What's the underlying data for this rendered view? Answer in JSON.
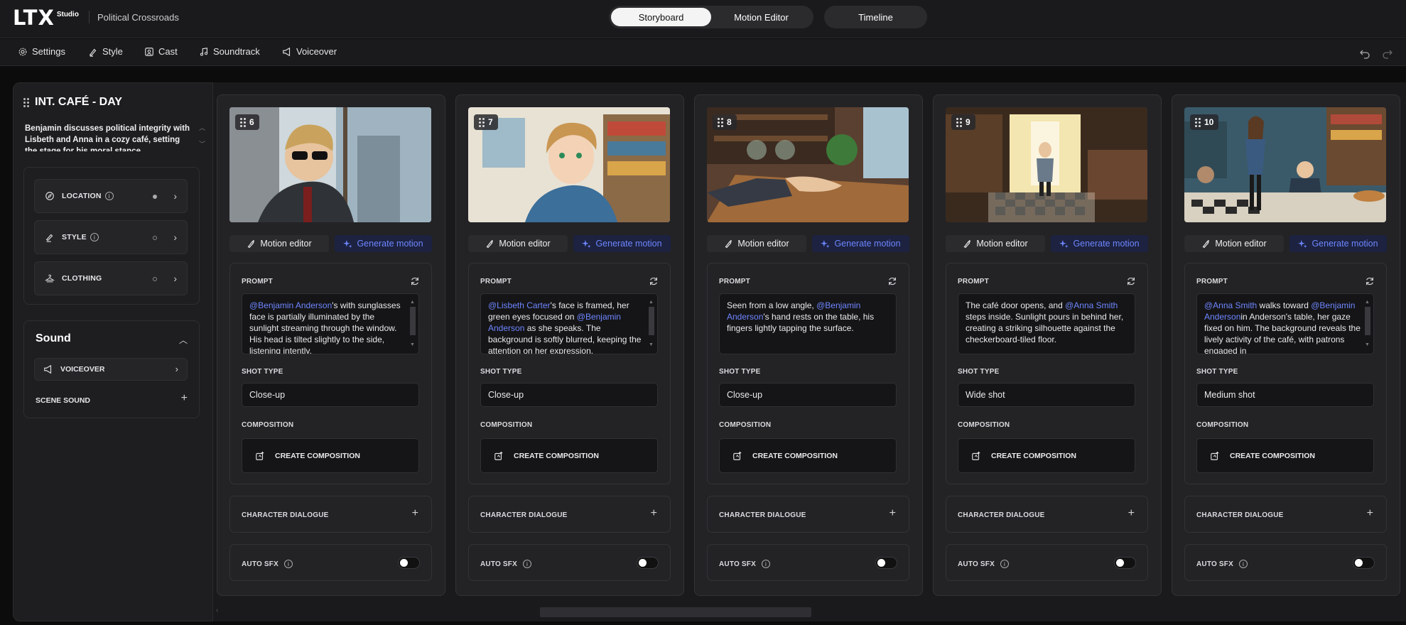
{
  "app": {
    "logo": "LTX",
    "logo_sub": "Studio",
    "project_title": "Political Crossroads"
  },
  "nav": {
    "storyboard": "Storyboard",
    "motion_editor": "Motion Editor",
    "timeline": "Timeline",
    "active": "Storyboard"
  },
  "toolbar": {
    "settings": "Settings",
    "style": "Style",
    "cast": "Cast",
    "soundtrack": "Soundtrack",
    "voiceover": "Voiceover"
  },
  "scene": {
    "title": "INT. CAFÉ - DAY",
    "description": "Benjamin discusses political integrity with Lisbeth and Anna in a cozy café, setting the stage for his moral stance.",
    "attributes": [
      {
        "label": "LOCATION",
        "icon": "compass-icon",
        "filled": true
      },
      {
        "label": "STYLE",
        "icon": "brush-icon",
        "filled": false
      },
      {
        "label": "CLOTHING",
        "icon": "hanger-icon",
        "filled": false
      }
    ],
    "sound": {
      "title": "Sound",
      "voiceover": "VOICEOVER",
      "scene_sound": "SCENE SOUND"
    }
  },
  "labels": {
    "motion_editor": "Motion editor",
    "generate_motion": "Generate motion",
    "prompt": "PROMPT",
    "shot_type": "SHOT TYPE",
    "composition": "COMPOSITION",
    "create_composition": "CREATE COMPOSITION",
    "character_dialogue": "CHARACTER DIALOGUE",
    "auto_sfx": "AUTO SFX"
  },
  "shots": [
    {
      "number": "6",
      "prompt": [
        {
          "t": "@Benjamin Anderson",
          "m": true
        },
        {
          "t": "'s with sunglasses face is partially illuminated by the sunlight streaming through the window. His head is tilted slightly to the side, listening intently.",
          "m": false
        }
      ],
      "shot_type": "Close-up",
      "has_scroll": true,
      "auto_sfx": false
    },
    {
      "number": "7",
      "prompt": [
        {
          "t": "@Lisbeth Carter",
          "m": true
        },
        {
          "t": "'s face is framed, her green eyes focused on ",
          "m": false
        },
        {
          "t": "@Benjamin Anderson",
          "m": true
        },
        {
          "t": " as she speaks. The background is softly blurred, keeping the attention on her expression.",
          "m": false
        }
      ],
      "shot_type": "Close-up",
      "has_scroll": true,
      "auto_sfx": false
    },
    {
      "number": "8",
      "prompt": [
        {
          "t": "Seen from a low angle, ",
          "m": false
        },
        {
          "t": "@Benjamin Anderson",
          "m": true
        },
        {
          "t": "'s hand rests on the table, his fingers lightly tapping the surface.",
          "m": false
        }
      ],
      "shot_type": "Close-up",
      "has_scroll": false,
      "auto_sfx": false
    },
    {
      "number": "9",
      "prompt": [
        {
          "t": "The café door opens, and ",
          "m": false
        },
        {
          "t": "@Anna Smith",
          "m": true
        },
        {
          "t": " steps inside. Sunlight pours in behind her, creating a striking silhouette against the checkerboard-tiled floor.",
          "m": false
        }
      ],
      "shot_type": "Wide shot",
      "has_scroll": false,
      "auto_sfx": false
    },
    {
      "number": "10",
      "prompt": [
        {
          "t": "@Anna Smith",
          "m": true
        },
        {
          "t": " walks toward ",
          "m": false
        },
        {
          "t": "@Benjamin Anderson",
          "m": true
        },
        {
          "t": "in Anderson's table, her gaze fixed on him. The background reveals the lively activity of the café, with patrons engaged in",
          "m": false
        }
      ],
      "shot_type": "Medium shot",
      "has_scroll": true,
      "auto_sfx": false
    }
  ],
  "colors": {
    "accent": "#6e86ff",
    "generate_bg": "#1c2240",
    "background": "#0c0c0d"
  }
}
